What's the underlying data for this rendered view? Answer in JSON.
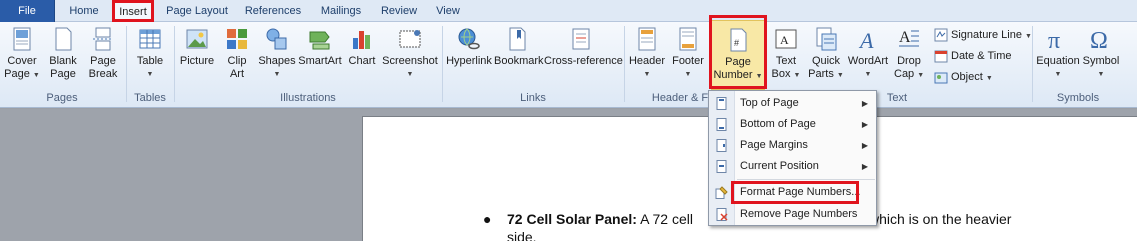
{
  "tabs": [
    {
      "label": "File"
    },
    {
      "label": "Home"
    },
    {
      "label": "Insert"
    },
    {
      "label": "Page Layout"
    },
    {
      "label": "References"
    },
    {
      "label": "Mailings"
    },
    {
      "label": "Review"
    },
    {
      "label": "View"
    }
  ],
  "groups": {
    "pages": "Pages",
    "tables": "Tables",
    "illustrations": "Illustrations",
    "links": "Links",
    "header_footer": "Header & F",
    "text": "Text",
    "symbols": "Symbols"
  },
  "buttons": {
    "cover_page": [
      "Cover",
      "Page"
    ],
    "blank_page": [
      "Blank",
      "Page"
    ],
    "page_break": [
      "Page",
      "Break"
    ],
    "table": "Table",
    "picture": "Picture",
    "clip_art": [
      "Clip",
      "Art"
    ],
    "shapes": "Shapes",
    "smartart": "SmartArt",
    "chart": "Chart",
    "screenshot": "Screenshot",
    "hyperlink": "Hyperlink",
    "bookmark": "Bookmark",
    "cross_reference": "Cross-reference",
    "header": "Header",
    "footer": "Footer",
    "page_number": [
      "Page",
      "Number"
    ],
    "text_box": [
      "Text",
      "Box"
    ],
    "quick_parts": [
      "Quick",
      "Parts"
    ],
    "wordart": "WordArt",
    "drop_cap": [
      "Drop",
      "Cap"
    ],
    "signature_line": "Signature Line",
    "date_time": "Date & Time",
    "object": "Object",
    "equation": "Equation",
    "symbol": "Symbol"
  },
  "menu": {
    "items": [
      {
        "label": "Top of Page",
        "submenu": true
      },
      {
        "label": "Bottom of Page",
        "submenu": true
      },
      {
        "label": "Page Margins",
        "submenu": true
      },
      {
        "label": "Current Position",
        "submenu": true
      },
      {
        "label": "Format Page Numbers...",
        "submenu": false
      },
      {
        "label": "Remove Page Numbers",
        "submenu": false
      }
    ]
  },
  "document": {
    "bullet_bold": "72 Cell Solar Panel:",
    "bullet_text": " A 72 cell",
    "bullet_tail": "which is on the heavier",
    "bullet_line2": "side."
  },
  "colors": {
    "highlight": "#e0141e",
    "file_tab": "#2a5ca8"
  }
}
